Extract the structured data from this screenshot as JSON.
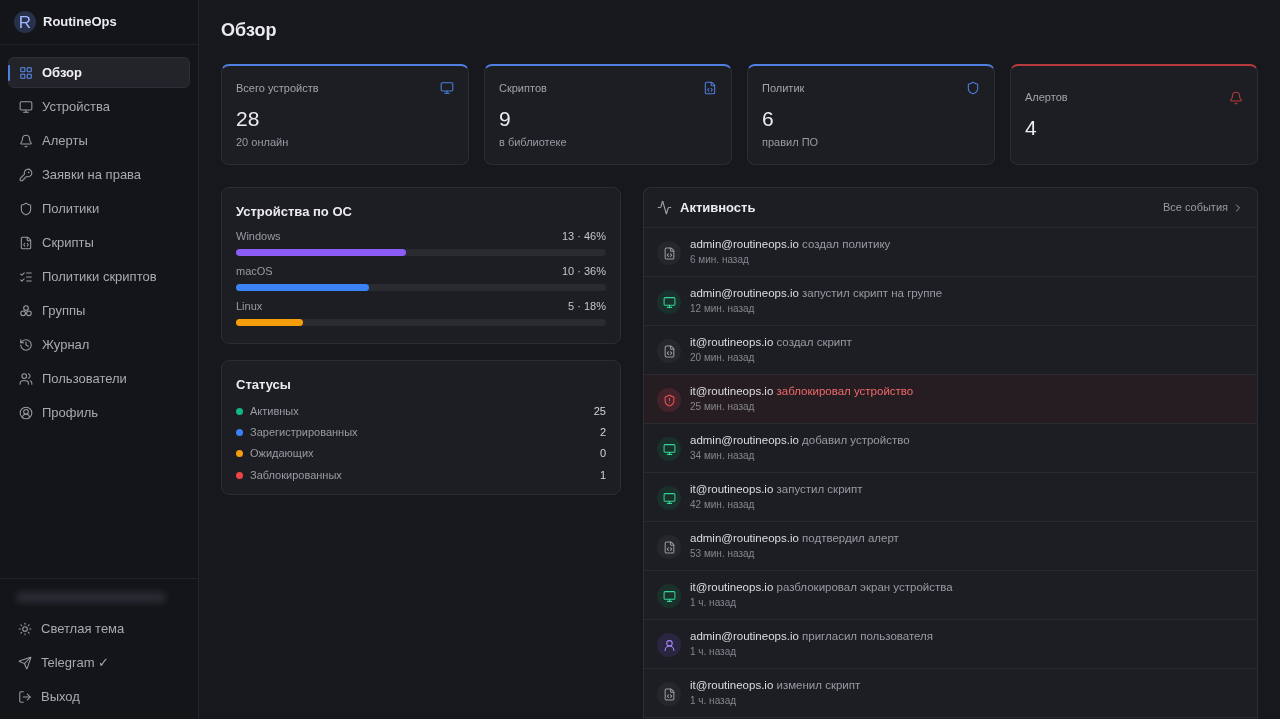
{
  "app": {
    "logo_letter": "R",
    "name": "RoutineOps"
  },
  "sidebar": {
    "items": [
      {
        "label": "Обзор",
        "selected": true
      },
      {
        "label": "Устройства",
        "selected": false
      },
      {
        "label": "Алерты",
        "selected": false
      },
      {
        "label": "Заявки на права",
        "selected": false
      },
      {
        "label": "Политики",
        "selected": false
      },
      {
        "label": "Скрипты",
        "selected": false
      },
      {
        "label": "Политики скриптов",
        "selected": false
      },
      {
        "label": "Группы",
        "selected": false
      },
      {
        "label": "Журнал",
        "selected": false
      },
      {
        "label": "Пользователи",
        "selected": false
      },
      {
        "label": "Профиль",
        "selected": false
      }
    ],
    "footer": [
      {
        "label": "Светлая тема"
      },
      {
        "label": "Telegram ✓"
      },
      {
        "label": "Выход"
      }
    ]
  },
  "page": {
    "title": "Обзор"
  },
  "stats": [
    {
      "label": "Всего устройств",
      "value": "28",
      "caption": "20 онлайн",
      "color": "#4f7fe0"
    },
    {
      "label": "Скриптов",
      "value": "9",
      "caption": "в библиотеке",
      "color": "#4f7fe0"
    },
    {
      "label": "Политик",
      "value": "6",
      "caption": "правил ПО",
      "color": "#4f7fe0"
    },
    {
      "label": "Алертов",
      "value": "4",
      "color": "#b83b3b"
    }
  ],
  "os_distribution": {
    "title": "Устройства по ОС",
    "items": [
      {
        "name": "Windows",
        "reading": "13 · 46%",
        "level": 0.46,
        "color": "#8b5cf6"
      },
      {
        "name": "macOS",
        "reading": "10 · 36%",
        "level": 0.36,
        "color": "#3b82f6"
      },
      {
        "name": "Linux",
        "reading": "5 · 18%",
        "level": 0.18,
        "color": "#f59e0b"
      }
    ]
  },
  "statuses": {
    "title": "Статусы",
    "items": [
      {
        "label": "Активных",
        "count": "25",
        "color": "#10b981"
      },
      {
        "label": "Зарегистрированных",
        "count": "2",
        "color": "#3b82f6"
      },
      {
        "label": "Ожидающих",
        "count": "0",
        "color": "#f59e0b"
      },
      {
        "label": "Заблокированных",
        "count": "1",
        "color": "#ef4444"
      }
    ]
  },
  "activity": {
    "title": "Активность",
    "link": "Все события",
    "items": [
      {
        "kind": "script",
        "user": "admin@routineops.io",
        "action": "создал политику",
        "time": "6 мин. назад"
      },
      {
        "kind": "device",
        "user": "admin@routineops.io",
        "action": "запустил скрипт на группе",
        "time": "12 мин. назад"
      },
      {
        "kind": "script",
        "user": "it@routineops.io",
        "action": "создал скрипт",
        "time": "20 мин. назад"
      },
      {
        "kind": "blocked",
        "user": "it@routineops.io",
        "action": "заблокировал устройство",
        "time": "25 мин. назад"
      },
      {
        "kind": "device",
        "user": "admin@routineops.io",
        "action": "добавил устройство",
        "time": "34 мин. назад"
      },
      {
        "kind": "device",
        "user": "it@routineops.io",
        "action": "запустил скрипт",
        "time": "42 мин. назад"
      },
      {
        "kind": "script",
        "user": "admin@routineops.io",
        "action": "подтвердил алерт",
        "time": "53 мин. назад"
      },
      {
        "kind": "device",
        "user": "it@routineops.io",
        "action": "разблокировал экран устройства",
        "time": "1 ч. назад"
      },
      {
        "kind": "user",
        "user": "admin@routineops.io",
        "action": "пригласил пользователя",
        "time": "1 ч. назад"
      },
      {
        "kind": "script",
        "user": "it@routineops.io",
        "action": "изменил скрипт",
        "time": "1 ч. назад"
      }
    ]
  }
}
